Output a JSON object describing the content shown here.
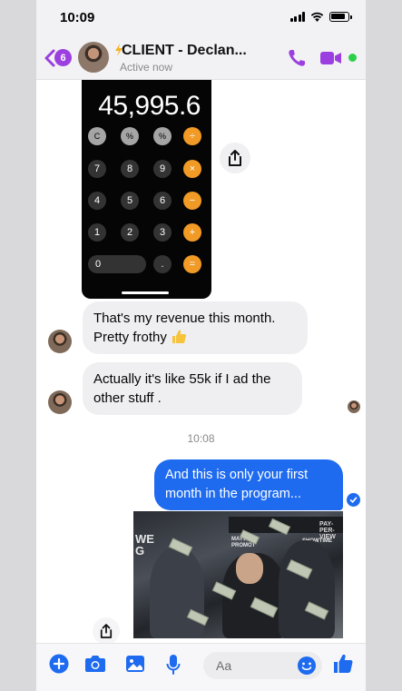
{
  "status_bar": {
    "time": "10:09"
  },
  "header": {
    "back_badge_count": "6",
    "contact_name": "CLIENT - Declan...",
    "active_status": "Active now"
  },
  "calculator_image": {
    "display": "45,995.6",
    "rows": [
      [
        "C",
        "%",
        "%",
        "÷"
      ],
      [
        "7",
        "8",
        "9",
        "×"
      ],
      [
        "4",
        "5",
        "6",
        "−"
      ],
      [
        "1",
        "2",
        "3",
        "+"
      ],
      [
        "0",
        ".",
        "="
      ]
    ]
  },
  "messages": {
    "incoming_1_line1": "That's my revenue this month.",
    "incoming_1_line2": "Pretty frothy",
    "incoming_2_line1": "Actually it's like 55k if I ad the",
    "incoming_2_line2": "other stuff .",
    "timestamp": "10:08",
    "outgoing_line1": "And this is only your first",
    "outgoing_line2": "month in the program..."
  },
  "meme_image": {
    "banner": "PAY-PER-VIEW",
    "logo_left": "MAYW\nPROMOT",
    "logo_right": "SHOWTIME\nPPV",
    "letters": "WE\nG"
  },
  "composer": {
    "placeholder": "Aa"
  },
  "colors": {
    "accent_purple": "#9b3fe0",
    "messenger_blue": "#1e6bf0",
    "online_green": "#2dcf4a",
    "calc_orange": "#f19a25"
  }
}
